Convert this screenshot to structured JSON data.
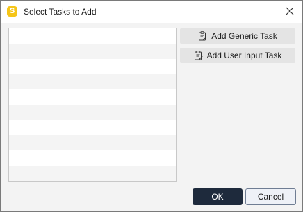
{
  "window": {
    "title": "Select Tasks to Add",
    "app_icon_letter": "S",
    "app_icon_color": "#f5c518"
  },
  "task_list": {
    "rows": [
      "",
      "",
      "",
      "",
      "",
      "",
      "",
      "",
      "",
      ""
    ]
  },
  "actions": {
    "add_generic_label": "Add Generic Task",
    "add_user_input_label": "Add User Input Task",
    "icon": "clipboard-edit-icon"
  },
  "footer": {
    "ok_label": "OK",
    "cancel_label": "Cancel",
    "ok_color": "#1e2a3c"
  }
}
